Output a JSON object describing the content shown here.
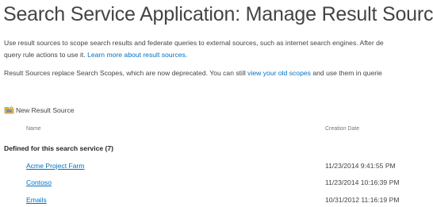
{
  "page": {
    "title": "Search Service Application: Manage Result Sources"
  },
  "intro": {
    "line1": "Use result sources to scope search results and federate queries to external sources, such as internet search engines. After de",
    "line2_text": "query rule actions to use it. ",
    "learn_more_link": "Learn more about result sources."
  },
  "deprecation": {
    "text_before": "Result Sources replace Search Scopes, which are now deprecated. You can still ",
    "old_scopes_link": "view your old scopes",
    "text_after": " and use them in querie"
  },
  "toolbar": {
    "new_result_source_label": "New Result Source",
    "new_icon": "new-item-icon"
  },
  "columns": {
    "name": "Name",
    "creation_date": "Creation Date"
  },
  "group": {
    "label": "Defined for this search service (7)"
  },
  "sources": [
    {
      "name": "Acme Project Farm",
      "created": "11/23/2014 9:41:55 PM"
    },
    {
      "name": "Contoso",
      "created": "11/23/2014 10:16:39 PM"
    },
    {
      "name": "Emails",
      "created": "10/31/2012 11:16:19 PM"
    }
  ],
  "colors": {
    "link": "#0072c6",
    "text": "#444444",
    "heading": "#444444"
  }
}
